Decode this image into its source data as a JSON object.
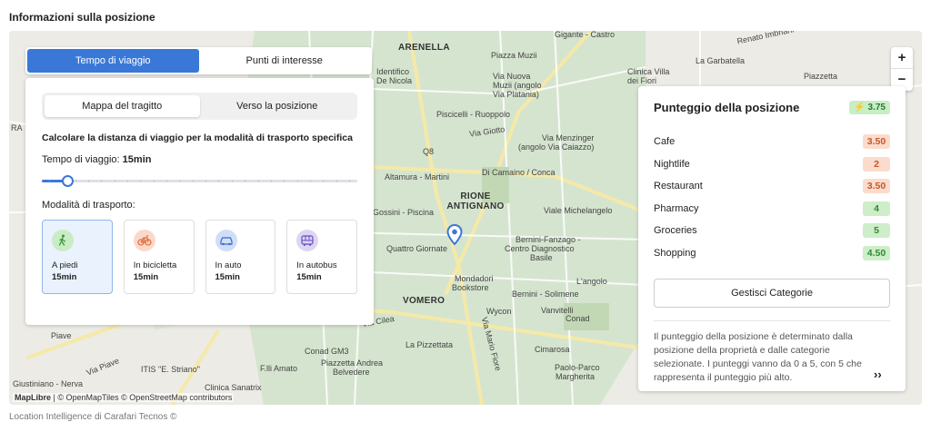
{
  "section_title": "Informazioni sulla posizione",
  "map": {
    "labels": {
      "arenella": "ARENELLA",
      "rione_antignano": "RIONE ANTIGNANO",
      "vomero": "VOMERO",
      "piazza_muzii": "Piazza Muzii",
      "via_nuova": "Via Nuova",
      "via_nuova_2": "Muzii (angolo",
      "via_nuova_3": "Via Platania)",
      "piscicelli": "Piscicelli - Ruoppolo",
      "via_giotto": "Via Giotto",
      "via_menzinger": "Via Menzinger",
      "via_menzinger_2": "(angolo Via Caiazzo)",
      "q8": "Q8",
      "di_camaino": "Di Camaino / Conca",
      "altamura": "Altamura - Martini",
      "gossini": "Gossini - Piscina",
      "viale_michelangelo": "Viale Michelangelo",
      "quattro_giornate": "Quattro Giornate",
      "bernini_fanzago": "Bernini-Fanzago -",
      "centro_diag": "Centro Diagnostico",
      "basile": "Basile",
      "mondadori": "Mondadori",
      "bookstore": "Bookstore",
      "langolo": "L'angolo",
      "bernini_solimene": "Bernini - Solimene",
      "wycon": "Wycon",
      "vanvitelli": "Vanvitelli",
      "conad": "Conad",
      "conad_gm3": "Conad GM3",
      "pizzettata": "La Pizzettata",
      "cimarosa": "Cimarosa",
      "piazzetta_andrea": "Piazzetta Andrea",
      "belvedere": "Belvedere",
      "paolo_parco": "Paolo-Parco",
      "margherita": "Margherita",
      "fili_amato": "F.lli Amato",
      "itis": "ITIS \"E. Striano\"",
      "giustiniano": "Giustiniano - Nerva",
      "clinica_sanatrix": "Clinica Sanatrix",
      "gigante": "Gigante - Castro",
      "renato_imbriani": "Renato Imbriani",
      "la_garbatella": "La Garbatella",
      "clinica_villa": "Clinica Villa",
      "dei_fiori": "dei Fiori",
      "piazzetta": "Piazzetta",
      "via_cilea": "Via Cilea",
      "piave": "Piave",
      "via_piave": "Via Piave",
      "via_mario": "Via Mario Fiore",
      "dentifico": "Identifico",
      "de_nicola": "De Nicola",
      "ra": "RA"
    },
    "zoom_in": "+",
    "zoom_out": "−",
    "attribution_brand": "MapLibre",
    "attribution_rest": " | © OpenMapTiles © OpenStreetMap contributors",
    "marker_icon": "location-pin-icon"
  },
  "left_panel": {
    "tabs": [
      "Tempo di viaggio",
      "Punti di interesse"
    ],
    "segments": [
      "Mappa del tragitto",
      "Verso la posizione"
    ],
    "heading": "Calcolare la distanza di viaggio per la modalità di trasporto specifica",
    "travel_time_label": "Tempo di viaggio: ",
    "travel_time_value": "15min",
    "slider_fraction": 0.08,
    "modes_label": "Modalità di trasporto:",
    "modes": [
      {
        "name": "A piedi",
        "time": "15min",
        "icon": "walk-icon",
        "color": "#c9ecc4",
        "fg": "#3a9a3a"
      },
      {
        "name": "In bicicletta",
        "time": "15min",
        "icon": "bicycle-icon",
        "color": "#fbd9c9",
        "fg": "#e06a3a"
      },
      {
        "name": "In auto",
        "time": "15min",
        "icon": "car-icon",
        "color": "#d0def6",
        "fg": "#3a6ad0"
      },
      {
        "name": "In autobus",
        "time": "15min",
        "icon": "bus-icon",
        "color": "#ddd6f3",
        "fg": "#6a4ac0"
      }
    ]
  },
  "score_panel": {
    "title": "Punteggio della posizione",
    "total": "3.75",
    "total_icon": "lightning-icon",
    "categories": [
      {
        "name": "Cafe",
        "value": "3.50",
        "bg": "#fbdccc",
        "fg": "#c8552a"
      },
      {
        "name": "Nightlife",
        "value": "2",
        "bg": "#fbdccc",
        "fg": "#c8552a"
      },
      {
        "name": "Restaurant",
        "value": "3.50",
        "bg": "#fbdccc",
        "fg": "#c8552a"
      },
      {
        "name": "Pharmacy",
        "value": "4",
        "bg": "#cdeec9",
        "fg": "#2f8a35"
      },
      {
        "name": "Groceries",
        "value": "5",
        "bg": "#cdeec9",
        "fg": "#2f8a35"
      },
      {
        "name": "Shopping",
        "value": "4.50",
        "bg": "#cdeec9",
        "fg": "#2f8a35"
      }
    ],
    "manage_label": "Gestisci Categorie",
    "explanation": "Il punteggio della posizione è determinato dalla posizione della proprietà e dalle categorie selezionate. I punteggi vanno da 0 a 5, con 5 che rappresenta il punteggio più alto.",
    "more": "››"
  },
  "footer": "Location Intelligence di Carafari Tecnos ©",
  "colors": {
    "accent": "#3a78d8"
  }
}
